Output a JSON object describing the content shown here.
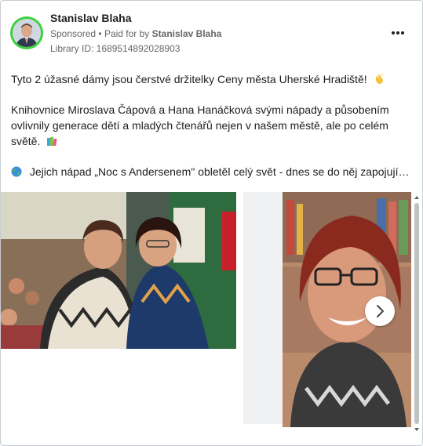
{
  "post": {
    "author": "Stanislav Blaha",
    "sponsored_label": "Sponsored",
    "paid_prefix": "Paid for by",
    "paid_by": "Stanislav Blaha",
    "library_id": "Library ID: 1689514892028903",
    "paragraph1": "Tyto 2 úžasné dámy jsou čerstvé držitelky Ceny města Uherské Hradiště!",
    "paragraph2": "Knihovnice Miroslava Čápová a Hana Hanáčková svými nápady a působením ovlivnily generace dětí a mladých čtenářů nejen v našem městě, ale po celém světě.",
    "paragraph3": "Jejich nápad „Noc s Andersenem\" obletěl celý svět - dnes se do něj zapojují…"
  },
  "icons": {
    "more": "more-horizontal-icon",
    "clap": "clapping-hands-emoji",
    "books": "books-emoji",
    "globe": "globe-emoji",
    "next": "chevron-right-icon"
  },
  "colors": {
    "avatar_ring": "#3dd13d",
    "text": "#1c1e21",
    "secondary": "#65676b"
  }
}
